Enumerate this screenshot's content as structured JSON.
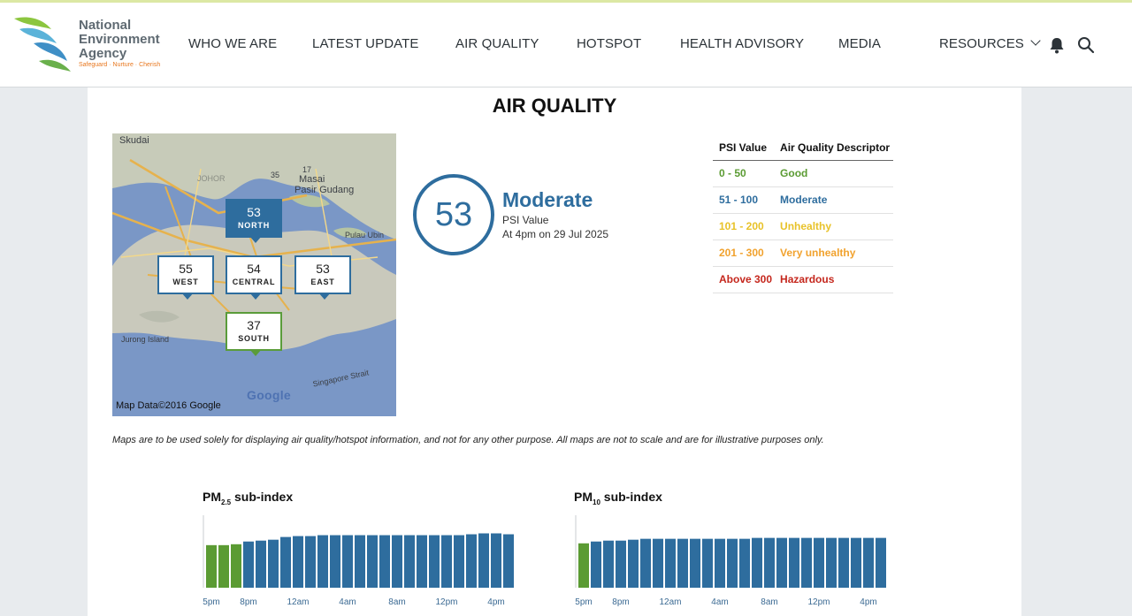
{
  "colors": {
    "good": "#5b9b33",
    "moderate": "#2e6d9e",
    "unhealthy": "#e8c229",
    "very_unhealthy": "#f1a22e",
    "hazardous": "#c5271d"
  },
  "logo": {
    "line1": "National",
    "line2": "Environment",
    "line3": "Agency",
    "tagline": "Safeguard · Nurture · Cherish"
  },
  "nav": [
    {
      "label": "WHO WE ARE"
    },
    {
      "label": "LATEST UPDATE"
    },
    {
      "label": "AIR QUALITY"
    },
    {
      "label": "HOTSPOT"
    },
    {
      "label": "HEALTH ADVISORY"
    },
    {
      "label": "MEDIA"
    },
    {
      "label": "RESOURCES"
    }
  ],
  "header_icons": [
    "bell-icon",
    "search-icon"
  ],
  "page_title": "AIR QUALITY",
  "map": {
    "credit": "Map Data©2016 Google",
    "google": "Google",
    "labels": [
      "Skudai",
      "JOHOR",
      "Masai",
      "Pasir Gudang",
      "Pulau Ubin",
      "Jurong Island",
      "Singapore Strait",
      "35",
      "17"
    ],
    "regions": [
      {
        "id": "north",
        "value": "53",
        "name": "NORTH"
      },
      {
        "id": "west",
        "value": "55",
        "name": "WEST"
      },
      {
        "id": "central",
        "value": "54",
        "name": "CENTRAL"
      },
      {
        "id": "east",
        "value": "53",
        "name": "EAST"
      },
      {
        "id": "south",
        "value": "37",
        "name": "SOUTH"
      }
    ]
  },
  "psi": {
    "value": "53",
    "descriptor": "Moderate",
    "label": "PSI Value",
    "time": "At 4pm on 29 Jul 2025"
  },
  "psi_table": {
    "headers": [
      "PSI Value",
      "Air Quality Descriptor"
    ],
    "rows": [
      {
        "range": "0 - 50",
        "descriptor": "Good",
        "color": "#5b9b33"
      },
      {
        "range": "51 - 100",
        "descriptor": "Moderate",
        "color": "#2e6d9e"
      },
      {
        "range": "101 - 200",
        "descriptor": "Unhealthy",
        "color": "#e8c229"
      },
      {
        "range": "201 - 300",
        "descriptor": "Very unhealthy",
        "color": "#f1a22e"
      },
      {
        "range": "Above 300",
        "descriptor": "Hazardous",
        "color": "#c5271d"
      }
    ]
  },
  "disclaimer": "Maps are to be used solely for displaying air quality/hotspot information, and not for any other purpose. All maps are not to scale and are for illustrative purposes only.",
  "chart_titles": {
    "pm25_main": "PM",
    "pm25_sub": "2.5",
    "pm10_main": "PM",
    "pm10_sub": "10",
    "suffix": " sub-index"
  },
  "chart_data": [
    {
      "type": "bar",
      "title": "PM2.5 sub-index",
      "tick_labels": [
        "5pm",
        "8pm",
        "12am",
        "4am",
        "8am",
        "12pm",
        "4pm"
      ],
      "hours": [
        "5pm",
        "6pm",
        "7pm",
        "8pm",
        "9pm",
        "10pm",
        "11pm",
        "12am",
        "1am",
        "2am",
        "3am",
        "4am",
        "5am",
        "6am",
        "7am",
        "8am",
        "9am",
        "10am",
        "11am",
        "12pm",
        "1pm",
        "2pm",
        "3pm",
        "4pm"
      ],
      "values": [
        47,
        47,
        48,
        51,
        52,
        53,
        56,
        57,
        57,
        58,
        58,
        58,
        58,
        58,
        58,
        58,
        58,
        58,
        58,
        58,
        58,
        59,
        60,
        60,
        59
      ],
      "ylim": [
        0,
        80
      ],
      "grid": false
    },
    {
      "type": "bar",
      "title": "PM10 sub-index",
      "tick_labels": [
        "5pm",
        "8pm",
        "12am",
        "4am",
        "8am",
        "12pm",
        "4pm"
      ],
      "values": [
        49,
        51,
        52,
        52,
        53,
        54,
        54,
        54,
        54,
        54,
        54,
        54,
        54,
        54,
        55,
        55,
        55,
        55,
        55,
        55,
        55,
        55,
        55,
        55,
        55
      ],
      "ylim": [
        0,
        80
      ],
      "grid": false
    }
  ]
}
